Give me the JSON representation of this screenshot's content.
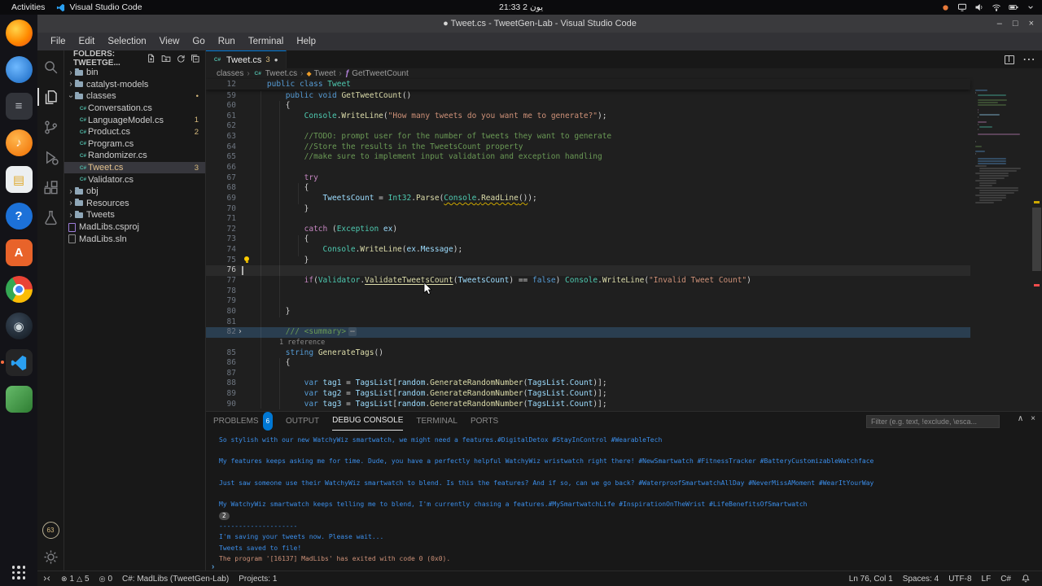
{
  "os_bar": {
    "activities": "Activities",
    "app_name": "Visual Studio Code",
    "clock": "21:33 2 يون",
    "tray_icons": [
      "record-dot-icon",
      "display-icon",
      "volume-icon",
      "network-icon",
      "battery-icon",
      "chevron-down-icon"
    ]
  },
  "window": {
    "title": "● Tweet.cs - TweetGen-Lab - Visual Studio Code",
    "controls": {
      "minimize": "–",
      "maximize": "□",
      "close": "×"
    }
  },
  "menubar": [
    "File",
    "Edit",
    "Selection",
    "View",
    "Go",
    "Run",
    "Terminal",
    "Help"
  ],
  "dock": {
    "items": [
      {
        "name": "firefox-icon",
        "shape": "circle",
        "bg": "radial-gradient(circle at 38% 35%, #ffd54a, #ff8a00 55%, #e64a19)",
        "glyph": ""
      },
      {
        "name": "thunderbird-icon",
        "shape": "circle",
        "bg": "radial-gradient(circle at 40% 40%, #6fb9ff, #1565c0)",
        "glyph": ""
      },
      {
        "name": "text-editor-icon",
        "shape": "square",
        "bg": "#32343a",
        "glyph": "≡",
        "glyph_color": "#b8bcc2"
      },
      {
        "name": "rhythmbox-icon",
        "shape": "circle",
        "bg": "radial-gradient(circle at 40% 35%, #ffb74d, #ef6c00)",
        "glyph": "♪",
        "glyph_color": "#fff3e0"
      },
      {
        "name": "libreoffice-writer-icon",
        "shape": "square",
        "bg": "#eceff1",
        "glyph": "▤",
        "glyph_color": "#dfa92e"
      },
      {
        "name": "help-icon",
        "shape": "circle",
        "bg": "#1c71d8",
        "glyph": "?",
        "glyph_color": "#ffffff"
      },
      {
        "name": "impress-icon",
        "shape": "square",
        "bg": "#e8632a",
        "glyph": "A",
        "glyph_color": "#ffffff"
      },
      {
        "name": "chrome-icon",
        "shape": "circle",
        "kind": "chrome"
      },
      {
        "name": "steam-icon",
        "shape": "circle",
        "bg": "radial-gradient(circle at 40% 35%, #3b4a5a, #10161d)",
        "glyph": "◉",
        "glyph_color": "#cfd8dc"
      },
      {
        "name": "vscode-icon",
        "shape": "square",
        "kind": "vscode",
        "bg": "#252526",
        "running": true
      },
      {
        "name": "green-app-icon",
        "shape": "square",
        "bg": "linear-gradient(135deg,#66bb6a,#2e7d32)",
        "glyph": ""
      }
    ]
  },
  "activity_bar": {
    "items": [
      {
        "name": "search"
      },
      {
        "name": "explorer",
        "active": true
      },
      {
        "name": "source-control"
      },
      {
        "name": "run-debug"
      },
      {
        "name": "extensions"
      },
      {
        "name": "testing"
      }
    ],
    "accounts_badge": "63"
  },
  "explorer": {
    "header": "FOLDERS: TWEETGE...",
    "items": [
      {
        "label": "bin",
        "type": "folder",
        "chevron": "closed"
      },
      {
        "label": "catalyst-models",
        "type": "folder",
        "chevron": "closed"
      },
      {
        "label": "classes",
        "type": "folder",
        "chevron": "open",
        "badge": "•"
      },
      {
        "label": "Conversation.cs",
        "type": "cs",
        "depth": 1
      },
      {
        "label": "LanguageModel.cs",
        "type": "cs",
        "depth": 1,
        "badge": "1"
      },
      {
        "label": "Product.cs",
        "type": "cs",
        "depth": 1,
        "badge": "2"
      },
      {
        "label": "Program.cs",
        "type": "cs",
        "depth": 1
      },
      {
        "label": "Randomizer.cs",
        "type": "cs",
        "depth": 1
      },
      {
        "label": "Tweet.cs",
        "type": "cs",
        "depth": 1,
        "badge": "3",
        "selected": true,
        "modified": true
      },
      {
        "label": "Validator.cs",
        "type": "cs",
        "depth": 1
      },
      {
        "label": "obj",
        "type": "folder",
        "chevron": "closed"
      },
      {
        "label": "Resources",
        "type": "folder",
        "chevron": "closed"
      },
      {
        "label": "Tweets",
        "type": "folder",
        "chevron": "closed"
      },
      {
        "label": "MadLibs.csproj",
        "type": "proj"
      },
      {
        "label": "MadLibs.sln",
        "type": "sln"
      }
    ]
  },
  "editor": {
    "tab": {
      "label": "Tweet.cs",
      "badge": "3",
      "dirty": "●"
    },
    "toolbar": [
      "split-editor-icon",
      "toggle-panel-icon",
      "more-actions-icon"
    ],
    "more_actions_glyph": "⋯",
    "breadcrumbs": [
      {
        "label": "classes"
      },
      {
        "label": "Tweet.cs",
        "icon": "cs"
      },
      {
        "label": "Tweet",
        "icon": "class"
      },
      {
        "label": "GetTweetCount",
        "icon": "method"
      }
    ],
    "sticky_line": {
      "n": "12",
      "segs": [
        [
          "    ",
          "pn"
        ],
        [
          "public",
          "kw"
        ],
        [
          " ",
          "pn"
        ],
        [
          "class",
          "kw"
        ],
        [
          " ",
          "pn"
        ],
        [
          "Tweet",
          "ty"
        ]
      ]
    },
    "code": {
      "lines": [
        {
          "n": "59",
          "segs": [
            [
              "        ",
              "pn"
            ],
            [
              "public",
              "kw"
            ],
            [
              " ",
              "pn"
            ],
            [
              "void",
              "kw"
            ],
            [
              " ",
              "pn"
            ],
            [
              "GetTweetCount",
              "fn"
            ],
            [
              "()",
              "pn"
            ]
          ]
        },
        {
          "n": "60",
          "segs": [
            [
              "        {",
              "pn"
            ]
          ]
        },
        {
          "n": "61",
          "segs": [
            [
              "            ",
              "pn"
            ],
            [
              "Console",
              "ty"
            ],
            [
              ".",
              "pn"
            ],
            [
              "WriteLine",
              "fn"
            ],
            [
              "(",
              "pn"
            ],
            [
              "\"How many tweets do you want me to generate?\"",
              "st"
            ],
            [
              ");",
              "pn"
            ]
          ]
        },
        {
          "n": "62",
          "segs": []
        },
        {
          "n": "63",
          "segs": [
            [
              "            ",
              "pn"
            ],
            [
              "//TODO: prompt user for the number of tweets they want to generate",
              "cm"
            ]
          ]
        },
        {
          "n": "64",
          "segs": [
            [
              "            ",
              "pn"
            ],
            [
              "//Store the results in the TweetsCount property",
              "cm"
            ]
          ]
        },
        {
          "n": "65",
          "segs": [
            [
              "            ",
              "pn"
            ],
            [
              "//make sure to implement input validation and exception handling",
              "cm"
            ]
          ]
        },
        {
          "n": "66",
          "segs": []
        },
        {
          "n": "67",
          "segs": [
            [
              "            ",
              "pn"
            ],
            [
              "try",
              "ctl"
            ]
          ]
        },
        {
          "n": "68",
          "segs": [
            [
              "            {",
              "pn"
            ]
          ]
        },
        {
          "n": "69",
          "segs": [
            [
              "                ",
              "pn"
            ],
            [
              "TweetsCount",
              "vr"
            ],
            [
              " = ",
              "pn"
            ],
            [
              "Int32",
              "ty"
            ],
            [
              ".",
              "pn"
            ],
            [
              "Parse",
              "fn"
            ],
            [
              "(",
              "pn"
            ],
            [
              "Console",
              "ty sqw"
            ],
            [
              ".",
              "pn sqw"
            ],
            [
              "ReadLine",
              "fn sqw"
            ],
            [
              "()",
              "pn sqw"
            ],
            [
              ");",
              "pn"
            ]
          ]
        },
        {
          "n": "70",
          "segs": [
            [
              "            }",
              "pn"
            ]
          ]
        },
        {
          "n": "71",
          "segs": []
        },
        {
          "n": "72",
          "segs": [
            [
              "            ",
              "pn"
            ],
            [
              "catch",
              "ctl"
            ],
            [
              " (",
              "pn"
            ],
            [
              "Exception",
              "ty"
            ],
            [
              " ",
              "pn"
            ],
            [
              "ex",
              "vr"
            ],
            [
              ")",
              "pn"
            ]
          ]
        },
        {
          "n": "73",
          "segs": [
            [
              "            {",
              "pn"
            ]
          ]
        },
        {
          "n": "74",
          "segs": [
            [
              "                ",
              "pn"
            ],
            [
              "Console",
              "ty"
            ],
            [
              ".",
              "pn"
            ],
            [
              "WriteLine",
              "fn"
            ],
            [
              "(",
              "pn"
            ],
            [
              "ex",
              "vr"
            ],
            [
              ".",
              "pn"
            ],
            [
              "Message",
              "vr"
            ],
            [
              ");",
              "pn"
            ]
          ]
        },
        {
          "n": "75",
          "segs": [
            [
              "            }",
              "pn"
            ]
          ]
        },
        {
          "n": "76",
          "segs": [],
          "cur": true
        },
        {
          "n": "77",
          "segs": [
            [
              "            ",
              "pn"
            ],
            [
              "if",
              "ctl"
            ],
            [
              "(",
              "pn"
            ],
            [
              "Validator",
              "ty"
            ],
            [
              ".",
              "pn"
            ],
            [
              "ValidateTweetsCount",
              "fn lnk"
            ],
            [
              "(",
              "pn"
            ],
            [
              "TweetsCount",
              "vr"
            ],
            [
              ") == ",
              "pn"
            ],
            [
              "false",
              "kw"
            ],
            [
              ") ",
              "pn"
            ],
            [
              "Console",
              "ty"
            ],
            [
              ".",
              "pn"
            ],
            [
              "WriteLine",
              "fn"
            ],
            [
              "(",
              "pn"
            ],
            [
              "\"Invalid Tweet Count\"",
              "st"
            ],
            [
              ")",
              "pn"
            ]
          ]
        },
        {
          "n": "78",
          "segs": []
        },
        {
          "n": "79",
          "segs": []
        },
        {
          "n": "80",
          "segs": [
            [
              "        }",
              "pn"
            ]
          ]
        },
        {
          "n": "81",
          "segs": []
        },
        {
          "n": "82",
          "segs": [
            [
              "        ",
              "pn"
            ],
            [
              "/// <summary>",
              "cm"
            ],
            [
              "⋯",
              "fold"
            ]
          ],
          "hl": true,
          "fold": true
        },
        {
          "lens": "1 reference"
        },
        {
          "n": "85",
          "segs": [
            [
              "        ",
              "pn"
            ],
            [
              "string",
              "kw"
            ],
            [
              " ",
              "pn"
            ],
            [
              "GenerateTags",
              "fn"
            ],
            [
              "()",
              "pn"
            ]
          ]
        },
        {
          "n": "86",
          "segs": [
            [
              "        {",
              "pn"
            ]
          ]
        },
        {
          "n": "87",
          "segs": []
        },
        {
          "n": "88",
          "segs": [
            [
              "            ",
              "pn"
            ],
            [
              "var",
              "kw"
            ],
            [
              " ",
              "pn"
            ],
            [
              "tag1",
              "vr"
            ],
            [
              " = ",
              "pn"
            ],
            [
              "TagsList",
              "vr"
            ],
            [
              "[",
              "pn"
            ],
            [
              "random",
              "vr"
            ],
            [
              ".",
              "pn"
            ],
            [
              "GenerateRandomNumber",
              "fn"
            ],
            [
              "(",
              "pn"
            ],
            [
              "TagsList",
              "vr"
            ],
            [
              ".",
              "pn"
            ],
            [
              "Count",
              "vr"
            ],
            [
              ")];",
              "pn"
            ]
          ]
        },
        {
          "n": "89",
          "segs": [
            [
              "            ",
              "pn"
            ],
            [
              "var",
              "kw"
            ],
            [
              " ",
              "pn"
            ],
            [
              "tag2",
              "vr"
            ],
            [
              " = ",
              "pn"
            ],
            [
              "TagsList",
              "vr"
            ],
            [
              "[",
              "pn"
            ],
            [
              "random",
              "vr"
            ],
            [
              ".",
              "pn"
            ],
            [
              "GenerateRandomNumber",
              "fn"
            ],
            [
              "(",
              "pn"
            ],
            [
              "TagsList",
              "vr"
            ],
            [
              ".",
              "pn"
            ],
            [
              "Count",
              "vr"
            ],
            [
              ")];",
              "pn"
            ]
          ]
        },
        {
          "n": "90",
          "segs": [
            [
              "            ",
              "pn"
            ],
            [
              "var",
              "kw"
            ],
            [
              " ",
              "pn"
            ],
            [
              "tag3",
              "vr"
            ],
            [
              " = ",
              "pn"
            ],
            [
              "TagsList",
              "vr"
            ],
            [
              "[",
              "pn"
            ],
            [
              "random",
              "vr"
            ],
            [
              ".",
              "pn"
            ],
            [
              "GenerateRandomNumber",
              "fn"
            ],
            [
              "(",
              "pn"
            ],
            [
              "TagsList",
              "vr"
            ],
            [
              ".",
              "pn"
            ],
            [
              "Count",
              "vr"
            ],
            [
              ")];",
              "pn"
            ]
          ]
        }
      ]
    }
  },
  "panel": {
    "tabs": [
      {
        "label": "PROBLEMS",
        "badge": "6"
      },
      {
        "label": "OUTPUT"
      },
      {
        "label": "DEBUG CONSOLE",
        "active": true
      },
      {
        "label": "TERMINAL"
      },
      {
        "label": "PORTS"
      }
    ],
    "filter_placeholder": "Filter (e.g. text, !exclude, \\esca...",
    "actions": [
      "chevron-up-icon",
      "close-icon"
    ],
    "prompt": "›",
    "console": [
      {
        "text": "So stylish with our new WatchyWiz smartwatch, we might need a features.#DigitalDetox #StayInControl #WearableTech",
        "gap": true
      },
      {
        "text": "My features keeps asking me for time. Dude, you have a perfectly helpful WatchyWiz wristwatch right there! #NewSmartwatch #FitnessTracker #BatteryCustomizableWatchface",
        "gap": true
      },
      {
        "text": "Just saw someone use their WatchyWiz smartwatch to blend. Is this the features? And if so, can we go back? #WaterproofSmartwatchAllDay #NeverMissAMoment #WearItYourWay",
        "gap": true
      },
      {
        "text": "My WatchyWiz smartwatch keeps telling me to blend, I'm currently chasing a features.#MySmartwatchLife #InspirationOnTheWrist #LifeBenefitsOfSmartwatch"
      },
      {
        "badge": "2"
      },
      {
        "text": "--------------------"
      },
      {
        "text": "I'm saving your tweets now. Please wait..."
      },
      {
        "text": "Tweets saved to file!"
      },
      {
        "text": "The program '[16137] MadLibs' has exited with code 0 (0x0).",
        "cls": "exit"
      }
    ]
  },
  "statusbar": {
    "left": [
      {
        "name": "remote-indicator",
        "icon": "remote",
        "text": ""
      },
      {
        "name": "problems-status",
        "icon": "error",
        "text": "1",
        "icon2": "warning",
        "text2": "5"
      },
      {
        "name": "ports-indicator",
        "icon": "target",
        "text": "0"
      },
      {
        "name": "csharp-project-status",
        "text": "C#: MadLibs (TweetGen-Lab)"
      },
      {
        "name": "projects-status",
        "text": "Projects: 1"
      }
    ],
    "right": [
      {
        "name": "cursor-position",
        "text": "Ln 76, Col 1"
      },
      {
        "name": "indentation",
        "text": "Spaces: 4"
      },
      {
        "name": "encoding",
        "text": "UTF-8"
      },
      {
        "name": "eol",
        "text": "LF"
      },
      {
        "name": "language-mode",
        "text": "C#"
      },
      {
        "name": "notifications-bell",
        "icon": "bell",
        "text": ""
      }
    ]
  },
  "colors": {
    "accent": "#0078d4",
    "editor_bg": "#1f1f1f",
    "panel_bg": "#181818",
    "console_info": "#3b8eea",
    "console_exit": "#ce9178",
    "warning": "#cca700",
    "modified_gold": "#e2c08d"
  }
}
